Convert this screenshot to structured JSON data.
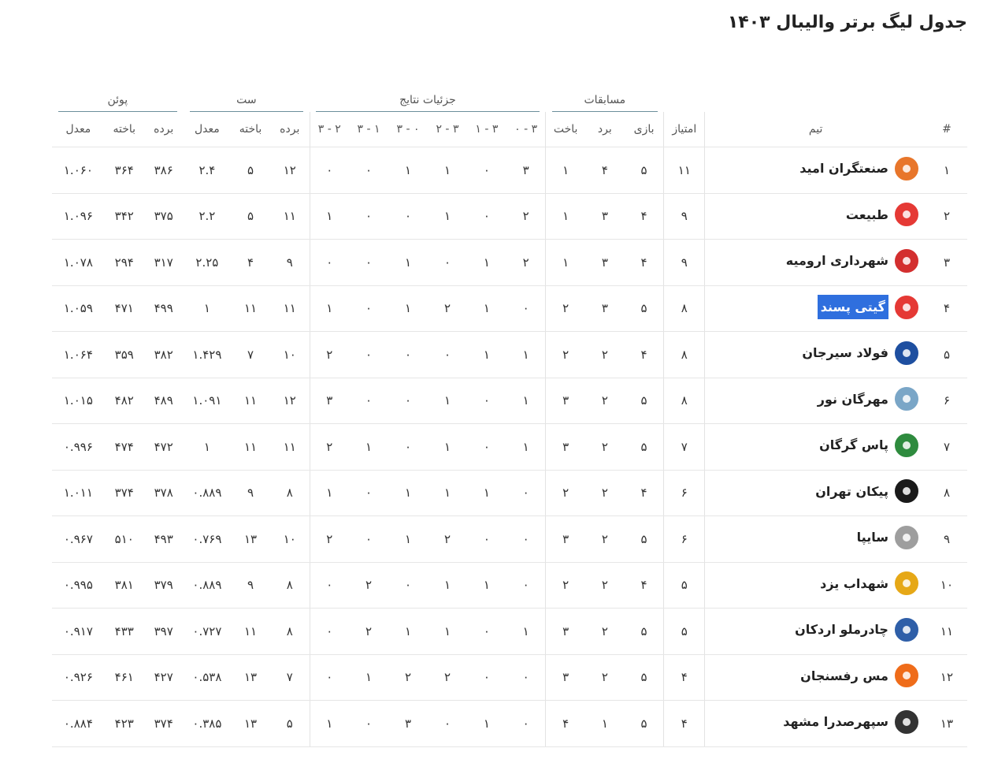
{
  "title": "جدول لیگ برتر والیبال ۱۴۰۳",
  "groups": {
    "matches": "مسابقات",
    "results": "جزئیات نتایج",
    "sets": "ست",
    "points": "پوئن"
  },
  "columns": {
    "rank": "#",
    "team": "تیم",
    "score": "امتیاز",
    "played": "بازی",
    "won": "برد",
    "lost": "باخت",
    "r30": "۳ - ۰",
    "r31": "۳ - ۱",
    "r32": "۳ - ۲",
    "r03": "۰ - ۳",
    "r13": "۱ - ۳",
    "r23": "۲ - ۳",
    "sets_won": "برده",
    "sets_lost": "باخته",
    "sets_avg": "معدل",
    "points_won": "برده",
    "points_lost": "باخته",
    "points_avg": "معدل"
  },
  "logo_colors": [
    "#e8762b",
    "#e53935",
    "#d32f2f",
    "#e53935",
    "#1e4fa0",
    "#7aa6c7",
    "#2e8b3e",
    "#1a1a1a",
    "#9e9e9e",
    "#e6a817",
    "#2f5fa8",
    "#ef6c1a",
    "#333333"
  ],
  "rows": [
    {
      "rank": "۱",
      "team": "صنعتگران امید",
      "score": "۱۱",
      "played": "۵",
      "won": "۴",
      "lost": "۱",
      "r30": "۳",
      "r31": "۰",
      "r32": "۱",
      "r03": "۱",
      "r13": "۰",
      "r23": "۰",
      "sets_won": "۱۲",
      "sets_lost": "۵",
      "sets_avg": "۲.۴",
      "points_won": "۳۸۶",
      "points_lost": "۳۶۴",
      "points_avg": "۱.۰۶۰"
    },
    {
      "rank": "۲",
      "team": "طبیعت",
      "score": "۹",
      "played": "۴",
      "won": "۳",
      "lost": "۱",
      "r30": "۲",
      "r31": "۰",
      "r32": "۱",
      "r03": "۰",
      "r13": "۰",
      "r23": "۱",
      "sets_won": "۱۱",
      "sets_lost": "۵",
      "sets_avg": "۲.۲",
      "points_won": "۳۷۵",
      "points_lost": "۳۴۲",
      "points_avg": "۱.۰۹۶"
    },
    {
      "rank": "۳",
      "team": "شهرداری ارومیه",
      "score": "۹",
      "played": "۴",
      "won": "۳",
      "lost": "۱",
      "r30": "۲",
      "r31": "۱",
      "r32": "۰",
      "r03": "۱",
      "r13": "۰",
      "r23": "۰",
      "sets_won": "۹",
      "sets_lost": "۴",
      "sets_avg": "۲.۲۵",
      "points_won": "۳۱۷",
      "points_lost": "۲۹۴",
      "points_avg": "۱.۰۷۸"
    },
    {
      "rank": "۴",
      "team": "گیتی پسند",
      "highlight": true,
      "score": "۸",
      "played": "۵",
      "won": "۳",
      "lost": "۲",
      "r30": "۰",
      "r31": "۱",
      "r32": "۲",
      "r03": "۱",
      "r13": "۰",
      "r23": "۱",
      "sets_won": "۱۱",
      "sets_lost": "۱۱",
      "sets_avg": "۱",
      "points_won": "۴۹۹",
      "points_lost": "۴۷۱",
      "points_avg": "۱.۰۵۹"
    },
    {
      "rank": "۵",
      "team": "فولاد سیرجان",
      "score": "۸",
      "played": "۴",
      "won": "۲",
      "lost": "۲",
      "r30": "۱",
      "r31": "۱",
      "r32": "۰",
      "r03": "۰",
      "r13": "۰",
      "r23": "۲",
      "sets_won": "۱۰",
      "sets_lost": "۷",
      "sets_avg": "۱.۴۲۹",
      "points_won": "۳۸۲",
      "points_lost": "۳۵۹",
      "points_avg": "۱.۰۶۴"
    },
    {
      "rank": "۶",
      "team": "مهرگان نور",
      "score": "۸",
      "played": "۵",
      "won": "۲",
      "lost": "۳",
      "r30": "۱",
      "r31": "۰",
      "r32": "۱",
      "r03": "۰",
      "r13": "۰",
      "r23": "۳",
      "sets_won": "۱۲",
      "sets_lost": "۱۱",
      "sets_avg": "۱.۰۹۱",
      "points_won": "۴۸۹",
      "points_lost": "۴۸۲",
      "points_avg": "۱.۰۱۵"
    },
    {
      "rank": "۷",
      "team": "پاس گرگان",
      "score": "۷",
      "played": "۵",
      "won": "۲",
      "lost": "۳",
      "r30": "۱",
      "r31": "۰",
      "r32": "۱",
      "r03": "۰",
      "r13": "۱",
      "r23": "۲",
      "sets_won": "۱۱",
      "sets_lost": "۱۱",
      "sets_avg": "۱",
      "points_won": "۴۷۲",
      "points_lost": "۴۷۴",
      "points_avg": "۰.۹۹۶"
    },
    {
      "rank": "۸",
      "team": "پیکان تهران",
      "score": "۶",
      "played": "۴",
      "won": "۲",
      "lost": "۲",
      "r30": "۰",
      "r31": "۱",
      "r32": "۱",
      "r03": "۱",
      "r13": "۰",
      "r23": "۱",
      "sets_won": "۸",
      "sets_lost": "۹",
      "sets_avg": "۰.۸۸۹",
      "points_won": "۳۷۸",
      "points_lost": "۳۷۴",
      "points_avg": "۱.۰۱۱"
    },
    {
      "rank": "۹",
      "team": "سایپا",
      "score": "۶",
      "played": "۵",
      "won": "۲",
      "lost": "۳",
      "r30": "۰",
      "r31": "۰",
      "r32": "۲",
      "r03": "۱",
      "r13": "۰",
      "r23": "۲",
      "sets_won": "۱۰",
      "sets_lost": "۱۳",
      "sets_avg": "۰.۷۶۹",
      "points_won": "۴۹۳",
      "points_lost": "۵۱۰",
      "points_avg": "۰.۹۶۷"
    },
    {
      "rank": "۱۰",
      "team": "شهداب یزد",
      "score": "۵",
      "played": "۴",
      "won": "۲",
      "lost": "۲",
      "r30": "۰",
      "r31": "۱",
      "r32": "۱",
      "r03": "۰",
      "r13": "۲",
      "r23": "۰",
      "sets_won": "۸",
      "sets_lost": "۹",
      "sets_avg": "۰.۸۸۹",
      "points_won": "۳۷۹",
      "points_lost": "۳۸۱",
      "points_avg": "۰.۹۹۵"
    },
    {
      "rank": "۱۱",
      "team": "چادرملو اردکان",
      "score": "۵",
      "played": "۵",
      "won": "۲",
      "lost": "۳",
      "r30": "۱",
      "r31": "۰",
      "r32": "۱",
      "r03": "۱",
      "r13": "۲",
      "r23": "۰",
      "sets_won": "۸",
      "sets_lost": "۱۱",
      "sets_avg": "۰.۷۲۷",
      "points_won": "۳۹۷",
      "points_lost": "۴۳۳",
      "points_avg": "۰.۹۱۷"
    },
    {
      "rank": "۱۲",
      "team": "مس رفسنجان",
      "score": "۴",
      "played": "۵",
      "won": "۲",
      "lost": "۳",
      "r30": "۰",
      "r31": "۰",
      "r32": "۲",
      "r03": "۲",
      "r13": "۱",
      "r23": "۰",
      "sets_won": "۷",
      "sets_lost": "۱۳",
      "sets_avg": "۰.۵۳۸",
      "points_won": "۴۲۷",
      "points_lost": "۴۶۱",
      "points_avg": "۰.۹۲۶"
    },
    {
      "rank": "۱۳",
      "team": "سپهرصدرا مشهد",
      "score": "۴",
      "played": "۵",
      "won": "۱",
      "lost": "۴",
      "r30": "۰",
      "r31": "۱",
      "r32": "۰",
      "r03": "۳",
      "r13": "۰",
      "r23": "۱",
      "sets_won": "۵",
      "sets_lost": "۱۳",
      "sets_avg": "۰.۳۸۵",
      "points_won": "۳۷۴",
      "points_lost": "۴۲۳",
      "points_avg": "۰.۸۸۴"
    }
  ]
}
